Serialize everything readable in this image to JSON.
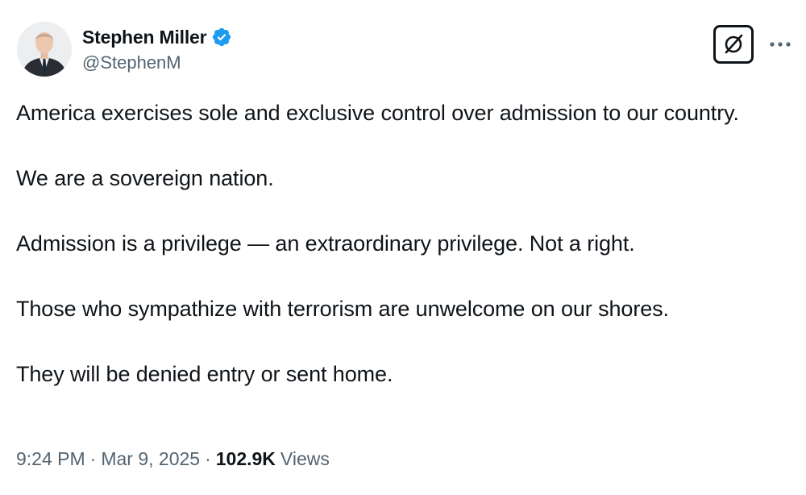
{
  "author": {
    "display_name": "Stephen Miller",
    "handle": "@StephenM",
    "verified": true,
    "verified_color": "#1d9bf0"
  },
  "header_actions": {
    "grok_icon": "grok-icon",
    "more_icon": "more-icon"
  },
  "tweet": {
    "paragraphs": [
      "America exercises sole and exclusive control over admission to our country.",
      "We are a sovereign nation.",
      "Admission is a privilege — an extraordinary privilege. Not a right.",
      "Those who sympathize with terrorism are unwelcome on our shores.",
      "They will be denied entry or sent home."
    ]
  },
  "meta": {
    "time": "9:24 PM",
    "separator": "·",
    "date": "Mar 9, 2025",
    "views_count": "102.9K",
    "views_label": "Views"
  }
}
